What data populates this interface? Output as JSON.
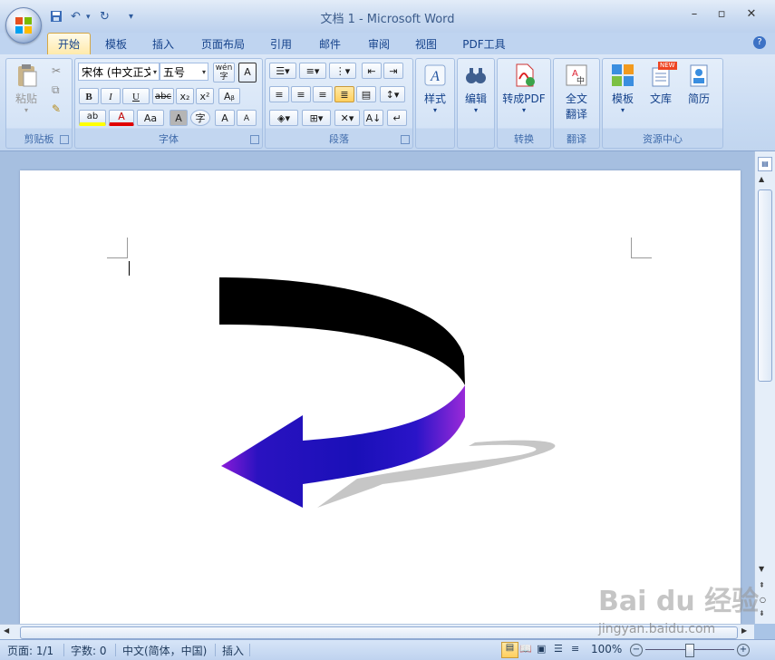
{
  "window": {
    "title": "文档 1 - Microsoft Word"
  },
  "tabs": [
    "开始",
    "模板",
    "插入",
    "页面布局",
    "引用",
    "邮件",
    "审阅",
    "视图",
    "PDF工具"
  ],
  "ribbon": {
    "clipboard": {
      "label": "剪贴板",
      "paste": "粘贴"
    },
    "font": {
      "label": "字体",
      "font_name": "宋体 (中文正文)",
      "font_size": "五号",
      "bold": "B",
      "italic": "I",
      "underline": "U",
      "strike": "abc",
      "sub": "x₂",
      "sup": "x²",
      "highlight": "ab",
      "fontcolor": "A",
      "case": "Aa",
      "charshade": "A",
      "encircle": "字",
      "grow": "A",
      "shrink": "A",
      "wen": "wén"
    },
    "paragraph": {
      "label": "段落"
    },
    "styles": {
      "label": "样式"
    },
    "editing": {
      "label": "编辑"
    },
    "convert": {
      "label": "转换",
      "pdf": "转成PDF"
    },
    "translate": {
      "label": "翻译",
      "full": "全文",
      "full2": "翻译"
    },
    "resources": {
      "label": "资源中心",
      "template": "模板",
      "library": "文库",
      "resume": "简历",
      "new_badge": "NEW"
    }
  },
  "status": {
    "page": "页面: 1/1",
    "words": "字数: 0",
    "lang": "中文(简体，中国)",
    "mode": "插入",
    "zoom": "100%"
  },
  "watermark": {
    "brand": "Bai du 经验",
    "url": "jingyan.baidu.com"
  },
  "colors": {
    "arrow_top": "#000000",
    "arrow_bottom_a": "#1a10b8",
    "arrow_bottom_b": "#8a1bd8",
    "shadow": "#c4c4c4"
  }
}
